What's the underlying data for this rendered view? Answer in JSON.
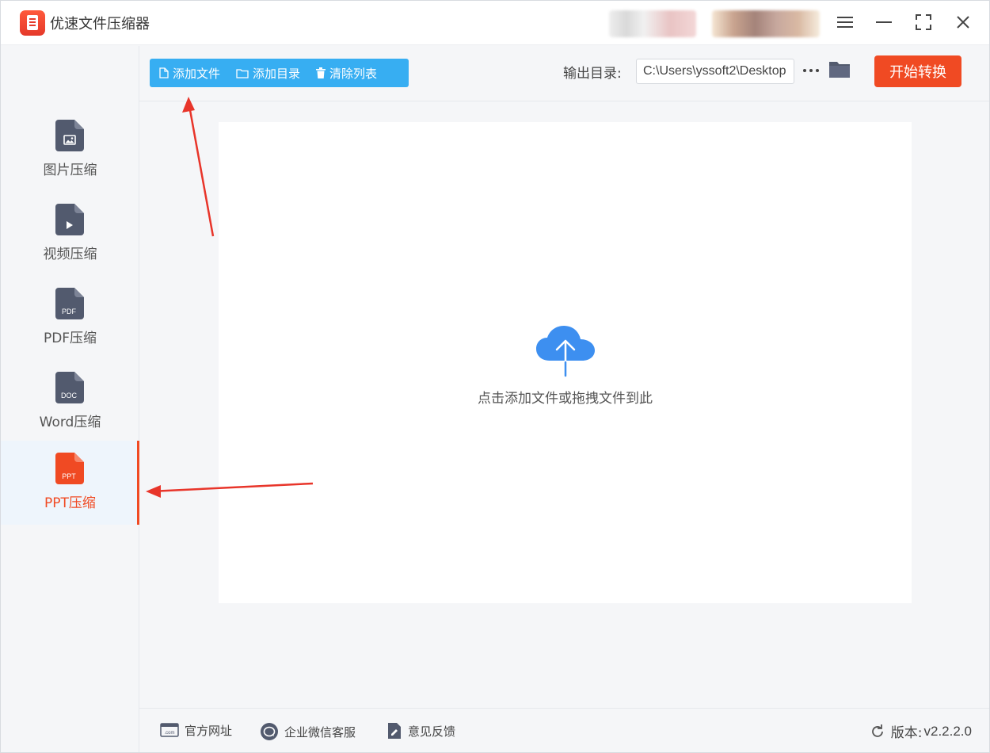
{
  "app": {
    "title": "优速文件压缩器"
  },
  "sidebar": {
    "items": [
      {
        "label": "图片压缩",
        "badge": "",
        "icon": "image-file-icon",
        "active": false
      },
      {
        "label": "视频压缩",
        "badge": "",
        "icon": "video-file-icon",
        "active": false
      },
      {
        "label": "PDF压缩",
        "badge": "PDF",
        "icon": "pdf-file-icon",
        "active": false
      },
      {
        "label": "Word压缩",
        "badge": "DOC",
        "icon": "doc-file-icon",
        "active": false
      },
      {
        "label": "PPT压缩",
        "badge": "PPT",
        "icon": "ppt-file-icon",
        "active": true
      }
    ]
  },
  "toolbar": {
    "add_file": "添加文件",
    "add_folder": "添加目录",
    "clear_list": "清除列表",
    "output_label": "输出目录:",
    "output_path": "C:\\Users\\yssoft2\\Desktop",
    "more": "···",
    "start": "开始转换"
  },
  "drop": {
    "text": "点击添加文件或拖拽文件到此"
  },
  "footer": {
    "website": "官方网址",
    "wechat": "企业微信客服",
    "feedback": "意见反馈",
    "version_label": "版本:",
    "version": "v2.2.2.0"
  },
  "colors": {
    "accent": "#f04a23",
    "toolbar_blue": "#37aef2",
    "icon_gray": "#525a6e",
    "cloud_blue": "#3d8ff0"
  }
}
